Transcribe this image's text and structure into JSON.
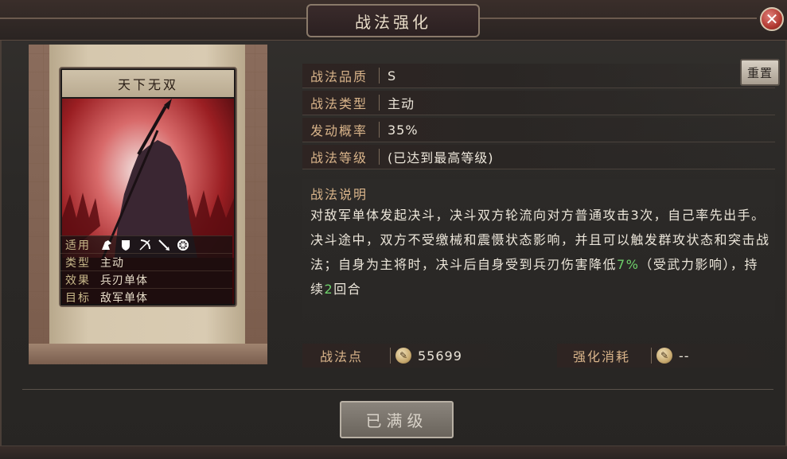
{
  "window": {
    "title": "战法强化"
  },
  "card": {
    "name": "天下无双",
    "rows": [
      {
        "key": "适用",
        "value": ""
      },
      {
        "key": "类型",
        "value": "主动"
      },
      {
        "key": "效果",
        "value": "兵刃单体"
      },
      {
        "key": "目标",
        "value": "敌军单体"
      }
    ],
    "use_icons": [
      "cavalry-icon",
      "shield-icon",
      "bow-icon",
      "spear-icon",
      "wheel-icon"
    ]
  },
  "info": {
    "quality": {
      "label": "战法品质",
      "value": "S"
    },
    "type": {
      "label": "战法类型",
      "value": "主动"
    },
    "rate": {
      "label": "发动概率",
      "value": "35%"
    },
    "level": {
      "label": "战法等级",
      "value": "(已达到最高等级)"
    },
    "reset_label": "重置"
  },
  "description": {
    "label": "战法说明",
    "part1": "对敌军单体发起决斗，决斗双方轮流向对方普通攻击3次，自己率先出手。决斗途中，双方不受缴械和震慑状态影响，并且可以触发群攻状态和突击战法；自身为主将时，决斗后自身受到兵刃伤害降低",
    "highlight1": "7%",
    "part2": "（受武力影响），持续",
    "highlight2": "2",
    "part3": "回合"
  },
  "points": {
    "label": "战法点",
    "value": "55699"
  },
  "cost": {
    "label": "强化消耗",
    "value": "--"
  },
  "max_button": "已满级",
  "colors": {
    "accent_label": "#d9b48a",
    "highlight": "#6ed06a",
    "close": "#b23a32"
  }
}
